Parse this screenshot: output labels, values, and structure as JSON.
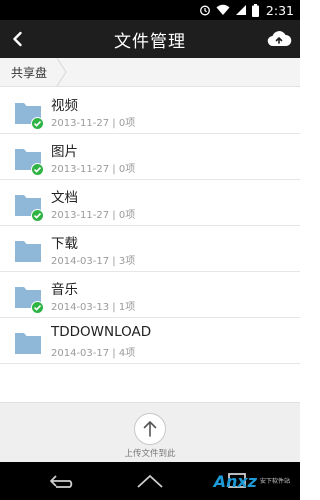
{
  "status_bar": {
    "time": "2:31"
  },
  "header": {
    "title": "文件管理"
  },
  "breadcrumb": {
    "current": "共享盘"
  },
  "files": [
    {
      "name": "视频",
      "meta": "2013-11-27 | 0项",
      "synced": true
    },
    {
      "name": "图片",
      "meta": "2013-11-27 | 0项",
      "synced": true
    },
    {
      "name": "文档",
      "meta": "2013-11-27 | 0项",
      "synced": true
    },
    {
      "name": "下载",
      "meta": "2014-03-17 | 3项",
      "synced": false
    },
    {
      "name": "音乐",
      "meta": "2014-03-13 | 1项",
      "synced": true
    },
    {
      "name": "TDDOWNLOAD",
      "meta": "2014-03-17 | 4项",
      "synced": false
    }
  ],
  "upload": {
    "label": "上传文件到此"
  },
  "watermark": {
    "brand": "Anxz",
    "sub": "安下软件站"
  },
  "colors": {
    "folder": "#8fb8d8",
    "sync_badge": "#2fb344",
    "title_bar": "#1e1e1e"
  }
}
